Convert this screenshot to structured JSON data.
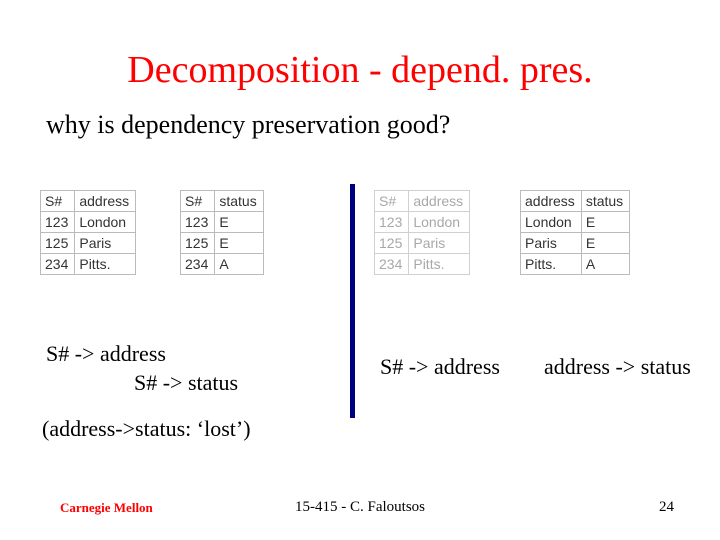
{
  "title": "Decomposition - depend. pres.",
  "subtitle": "why is dependency preservation good?",
  "tables": {
    "left1": {
      "headers": [
        "S#",
        "address"
      ],
      "rows": [
        [
          "123",
          "London"
        ],
        [
          "125",
          "Paris"
        ],
        [
          "234",
          "Pitts."
        ]
      ]
    },
    "left2": {
      "headers": [
        "S#",
        "status"
      ],
      "rows": [
        [
          "123",
          "E"
        ],
        [
          "125",
          "E"
        ],
        [
          "234",
          "A"
        ]
      ]
    },
    "right1": {
      "headers": [
        "S#",
        "address"
      ],
      "rows": [
        [
          "123",
          "London"
        ],
        [
          "125",
          "Paris"
        ],
        [
          "234",
          "Pitts."
        ]
      ]
    },
    "right2": {
      "headers": [
        "address",
        "status"
      ],
      "rows": [
        [
          "London",
          "E"
        ],
        [
          "Paris",
          "E"
        ],
        [
          "Pitts.",
          "A"
        ]
      ]
    }
  },
  "deps": {
    "left_line1": "S# -> address",
    "left_line2": "S# -> status",
    "mid": "S# -> address",
    "right": "address -> status"
  },
  "lost": "(address->status: ‘lost’)",
  "footer": {
    "org": "Carnegie Mellon",
    "center": "15-415 - C. Faloutsos",
    "page": "24"
  }
}
